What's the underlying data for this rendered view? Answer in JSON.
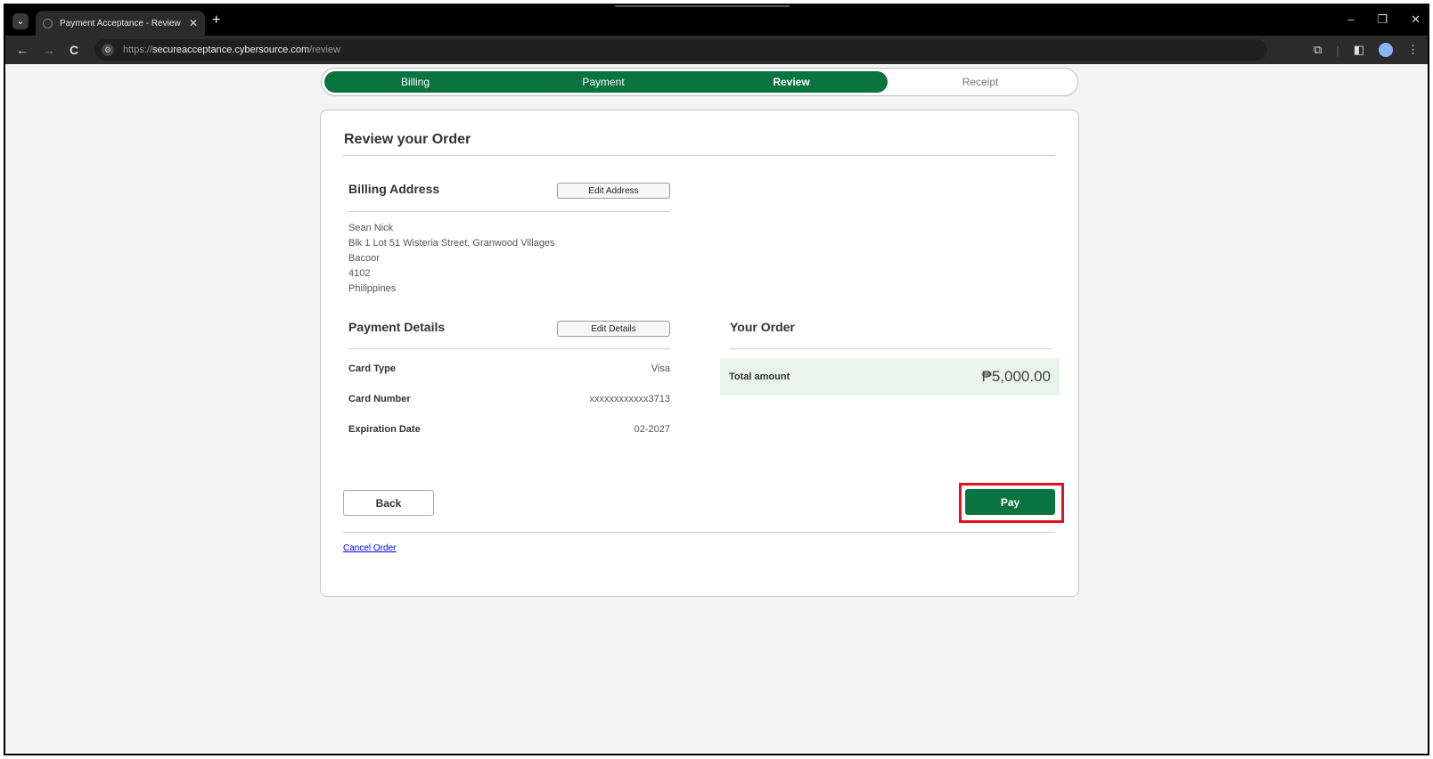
{
  "browser": {
    "tab_title": "Payment Acceptance - Review [",
    "tab_close": "✕",
    "new_tab": "+",
    "url_scheme": "https://",
    "url_host": "secureacceptance.cybersource.com",
    "url_path": "/review",
    "window_controls": {
      "minimize": "–",
      "restore": "❐",
      "close": "✕"
    },
    "nav": {
      "back": "←",
      "forward": "→",
      "reload": "C"
    }
  },
  "steps": [
    {
      "label": "Billing",
      "state": "done"
    },
    {
      "label": "Payment",
      "state": "done"
    },
    {
      "label": "Review",
      "state": "active"
    },
    {
      "label": "Receipt",
      "state": "todo"
    }
  ],
  "page_title": "Review your Order",
  "billing": {
    "heading": "Billing Address",
    "edit_label": "Edit Address",
    "name": "Sean Nick",
    "street": "Blk 1 Lot 51 Wisteria Street, Granwood Villages",
    "city": "Bacoor",
    "postal": "4102",
    "country": "Philippines"
  },
  "payment": {
    "heading": "Payment Details",
    "edit_label": "Edit Details",
    "rows": [
      {
        "label": "Card Type",
        "value": "Visa"
      },
      {
        "label": "Card Number",
        "value": "xxxxxxxxxxxx3713"
      },
      {
        "label": "Expiration Date",
        "value": "02-2027"
      }
    ]
  },
  "order": {
    "heading": "Your Order",
    "total_label": "Total amount",
    "total_value": "₱5,000.00"
  },
  "actions": {
    "back_label": "Back",
    "pay_label": "Pay",
    "cancel_label": "Cancel Order"
  },
  "colors": {
    "brand_green": "#0a7340",
    "highlight_red": "#e0121d",
    "total_bg": "#e9f5ea"
  }
}
